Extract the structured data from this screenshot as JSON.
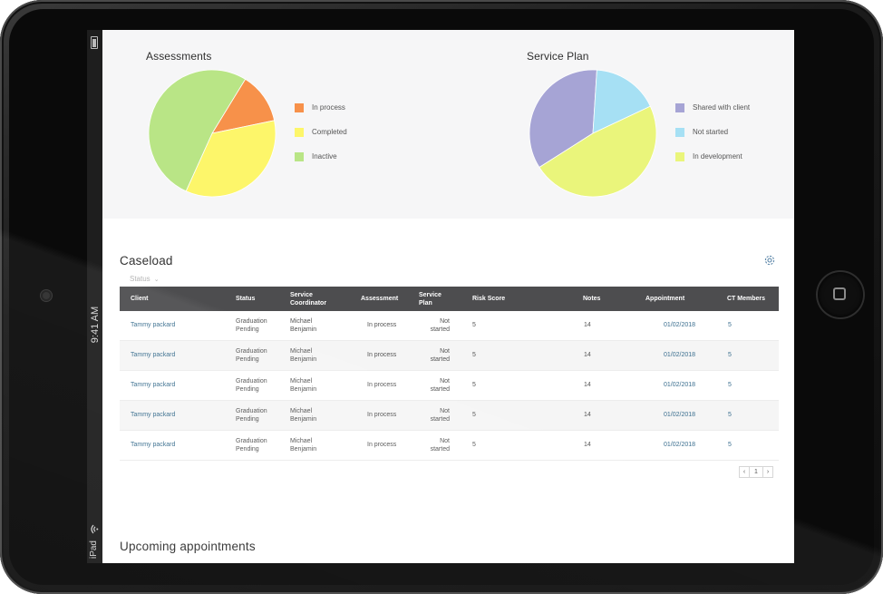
{
  "device": {
    "status_time": "9:41 AM",
    "status_carrier": "iPad"
  },
  "charts": {
    "assessments": {
      "title": "Assessments",
      "chart_data": {
        "type": "pie",
        "title": "Assessments",
        "slices": [
          {
            "label": "In process",
            "value": 13,
            "color": "#f7914a"
          },
          {
            "label": "Completed",
            "value": 35,
            "color": "#fdf66a"
          },
          {
            "label": "Inactive",
            "value": 52,
            "color": "#b9e586"
          }
        ]
      }
    },
    "service_plan": {
      "title": "Service Plan",
      "chart_data": {
        "type": "pie",
        "title": "Service Plan",
        "slices": [
          {
            "label": "Shared with client",
            "value": 35,
            "color": "#a6a4d5"
          },
          {
            "label": "Not started",
            "value": 17,
            "color": "#a6e0f4"
          },
          {
            "label": "In development",
            "value": 48,
            "color": "#eaf57b"
          }
        ]
      }
    }
  },
  "caseload": {
    "title": "Caseload",
    "status_filter": "Status",
    "columns": [
      "Client",
      "Status",
      "Service\nCoordinator",
      "Assessment",
      "Service\nPlan",
      "Risk Score",
      "Notes",
      "Appointment",
      "CT Members"
    ],
    "rows": [
      {
        "client": "Tammy packard",
        "status": "Graduation\nPending",
        "coordinator": "Michael\nBenjamin",
        "assessment": "In process",
        "plan": "Not\nstarted",
        "risk": "5",
        "notes": "14",
        "appointment": "01/02/2018",
        "ct": "5"
      },
      {
        "client": "Tammy packard",
        "status": "Graduation\nPending",
        "coordinator": "Michael\nBenjamin",
        "assessment": "In process",
        "plan": "Not\nstarted",
        "risk": "5",
        "notes": "14",
        "appointment": "01/02/2018",
        "ct": "5"
      },
      {
        "client": "Tammy packard",
        "status": "Graduation\nPending",
        "coordinator": "Michael\nBenjamin",
        "assessment": "In process",
        "plan": "Not\nstarted",
        "risk": "5",
        "notes": "14",
        "appointment": "01/02/2018",
        "ct": "5"
      },
      {
        "client": "Tammy packard",
        "status": "Graduation\nPending",
        "coordinator": "Michael\nBenjamin",
        "assessment": "In process",
        "plan": "Not\nstarted",
        "risk": "5",
        "notes": "14",
        "appointment": "01/02/2018",
        "ct": "5"
      },
      {
        "client": "Tammy packard",
        "status": "Graduation\nPending",
        "coordinator": "Michael\nBenjamin",
        "assessment": "In process",
        "plan": "Not\nstarted",
        "risk": "5",
        "notes": "14",
        "appointment": "01/02/2018",
        "ct": "5"
      }
    ],
    "pagination": {
      "prev": "‹",
      "page": "1",
      "next": "›"
    }
  },
  "appointments": {
    "title": "Upcoming appointments"
  },
  "icons": {
    "settings": "gear-icon",
    "battery": "battery-icon",
    "wifi": "wifi-icon"
  },
  "colors": {
    "table_header": "#4d4d4f",
    "link": "#3b6f8f",
    "panel_bg": "#f6f6f7"
  }
}
